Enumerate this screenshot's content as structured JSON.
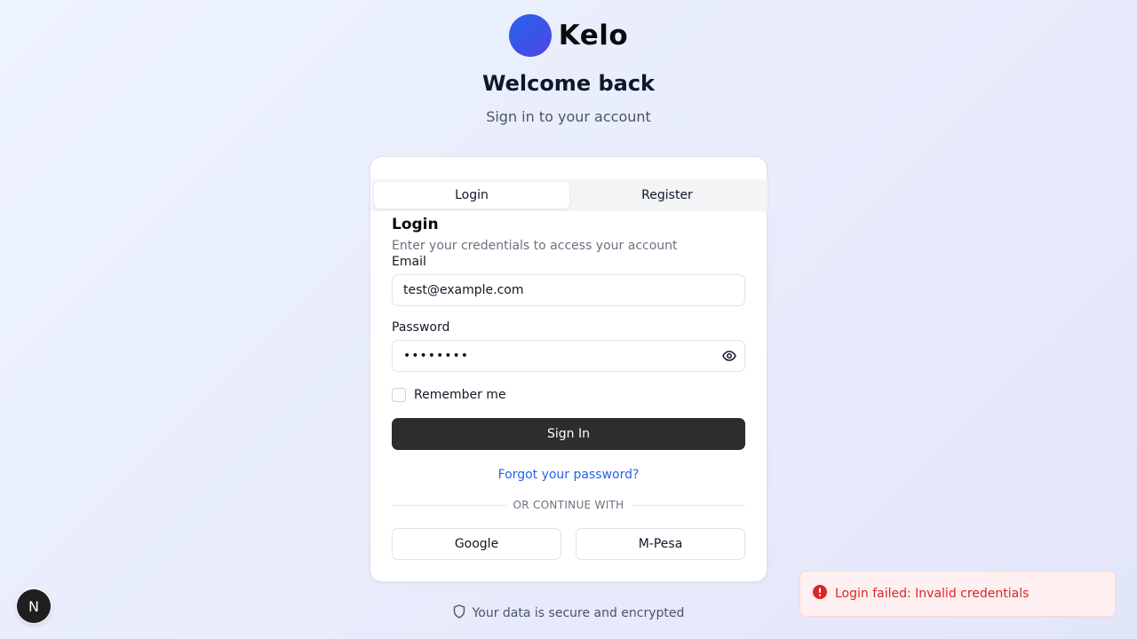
{
  "brand": {
    "name": "Kelo",
    "logo_colors": [
      "#2563eb",
      "#4f46e5"
    ]
  },
  "header": {
    "title": "Welcome back",
    "subtitle": "Sign in to your account"
  },
  "tabs": [
    {
      "label": "Login",
      "active": true
    },
    {
      "label": "Register",
      "active": false
    }
  ],
  "form": {
    "title": "Login",
    "description": "Enter your credentials to access your account",
    "email_label": "Email",
    "email_value": "test@example.com",
    "password_label": "Password",
    "password_value": "password",
    "remember_label": "Remember me",
    "remember_checked": false,
    "submit_label": "Sign In",
    "forgot_label": "Forgot your password?",
    "divider_label": "OR CONTINUE WITH",
    "social": [
      {
        "label": "Google"
      },
      {
        "label": "M-Pesa"
      }
    ]
  },
  "footer": {
    "secure_text": "Your data is secure and encrypted"
  },
  "toast": {
    "message": "Login failed: Invalid credentials",
    "color": "#dc2626"
  },
  "dev_badge": {
    "letter": "N"
  },
  "icons": {
    "eye": "eye-icon",
    "shield": "shield-icon",
    "alert": "alert-circle-icon"
  },
  "colors": {
    "accent": "#2563eb",
    "button_dark": "#2d2d2d",
    "error": "#dc2626"
  }
}
